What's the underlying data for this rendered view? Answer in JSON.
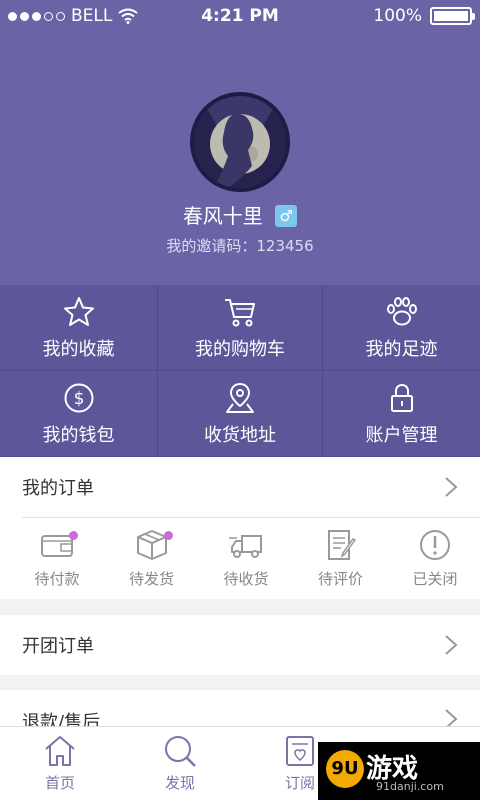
{
  "status_bar": {
    "carrier": "BELL",
    "time": "4:21 PM",
    "battery": "100%",
    "battery_level": 1.0
  },
  "profile": {
    "username": "春风十里",
    "gender_symbol": "♂",
    "invite_label": "我的邀请码：123456"
  },
  "menu_grid": [
    {
      "label": "我的收藏",
      "icon": "star-icon"
    },
    {
      "label": "我的购物车",
      "icon": "cart-icon"
    },
    {
      "label": "我的足迹",
      "icon": "paw-icon"
    },
    {
      "label": "我的钱包",
      "icon": "dollar-coin-icon"
    },
    {
      "label": "收货地址",
      "icon": "location-pin-icon"
    },
    {
      "label": "账户管理",
      "icon": "lock-icon"
    }
  ],
  "orders": {
    "title": "我的订单",
    "statuses": [
      {
        "label": "待付款",
        "icon": "wallet-icon",
        "dot": true
      },
      {
        "label": "待发货",
        "icon": "package-icon",
        "dot": true
      },
      {
        "label": "待收货",
        "icon": "truck-icon",
        "dot": false
      },
      {
        "label": "待评价",
        "icon": "edit-document-icon",
        "dot": false
      },
      {
        "label": "已关闭",
        "icon": "exclamation-circle-icon",
        "dot": false
      }
    ]
  },
  "group_orders": {
    "title": "开团订单"
  },
  "refunds": {
    "title": "退款/售后"
  },
  "tabbar": [
    {
      "label": "首页",
      "icon": "home-icon"
    },
    {
      "label": "发现",
      "icon": "search-icon"
    },
    {
      "label": "订阅",
      "icon": "subscribe-icon"
    },
    {
      "label": "",
      "icon": "profile-icon"
    }
  ],
  "watermark": {
    "logo": "9U",
    "name": "游戏",
    "site": "91danji.com"
  },
  "colors": {
    "header_bg": "#6a63a6",
    "grid_bg": "#5d5799",
    "badge": "#cc6bd6",
    "tab_color": "#7a75a8"
  }
}
